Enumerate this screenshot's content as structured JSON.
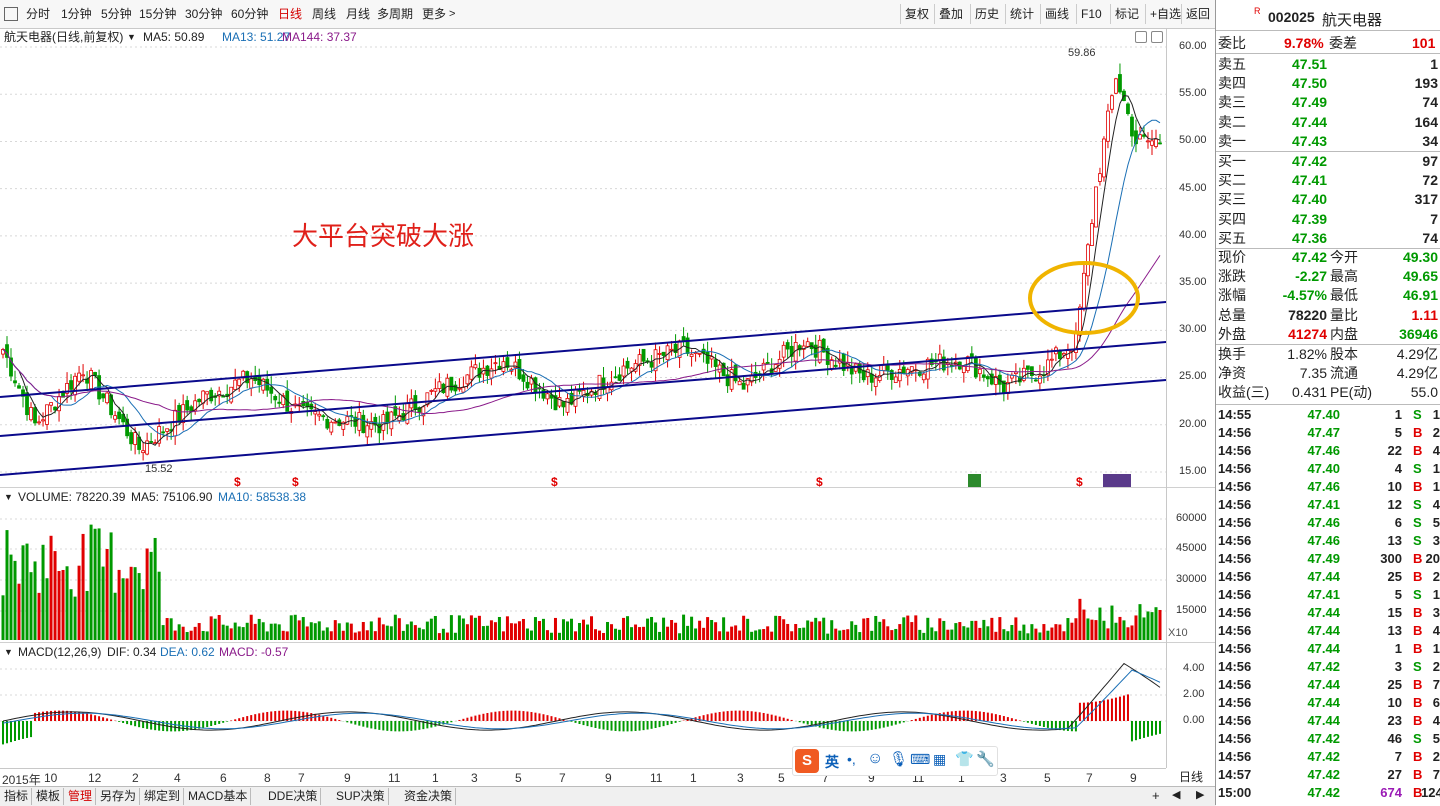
{
  "toolbar": {
    "periods": [
      "分时",
      "1分钟",
      "5分钟",
      "15分钟",
      "30分钟",
      "60分钟",
      "日线",
      "周线",
      "月线",
      "多周期",
      "更多"
    ],
    "active_period": "日线",
    "right_buttons": [
      "复权",
      "叠加",
      "历史",
      "统计",
      "画线",
      "F10",
      "标记",
      "+自选",
      "返回"
    ]
  },
  "chart_info": {
    "stock_label": "航天电器(日线,前复权)",
    "ma5": "MA5: 50.89",
    "ma13": "MA13: 51.27",
    "ma144": "MA144: 37.37",
    "volume": "VOLUME: 78220.39",
    "vol_ma5": "MA5: 75106.90",
    "vol_ma10": "MA10: 58538.38",
    "macd": "MACD(12,26,9)",
    "dif": "DIF: 0.34",
    "dea": "DEA: 0.62",
    "macd_val": "MACD: -0.57"
  },
  "annotations": {
    "title": "大平台突破大涨",
    "high_label": "59.86",
    "low_label": "15.52",
    "x10": "X10"
  },
  "price_axis": [
    "60.00",
    "55.00",
    "50.00",
    "45.00",
    "40.00",
    "35.00",
    "30.00",
    "25.00",
    "20.00",
    "15.00"
  ],
  "volume_axis": [
    "60000",
    "45000",
    "30000",
    "15000"
  ],
  "macd_axis": [
    "4.00",
    "2.00",
    "0.00"
  ],
  "date_axis": [
    "2015年",
    "10",
    "12",
    "2",
    "4",
    "6",
    "8",
    "7",
    "9",
    "11",
    "1",
    "3",
    "5",
    "7",
    "9",
    "11",
    "1",
    "3",
    "5",
    "7",
    "9",
    "11",
    "1",
    "3",
    "5",
    "7",
    "9"
  ],
  "bottom_tabs": [
    "指标",
    "模板",
    "管理",
    "另存为",
    "绑定到",
    "MACD基本",
    "DDE决策",
    "SUP决策",
    "资金决策"
  ],
  "bottom_active": "管理",
  "period_tag": "日线",
  "ime": [
    "英",
    "设置"
  ],
  "quote": {
    "code": "002025",
    "name": "航天电器",
    "weibi_label": "委比",
    "weibi": "9.78%",
    "weicha_label": "委差",
    "weicha": "101",
    "sells": [
      {
        "label": "卖五",
        "price": "47.51",
        "vol": "1"
      },
      {
        "label": "卖四",
        "price": "47.50",
        "vol": "193"
      },
      {
        "label": "卖三",
        "price": "47.49",
        "vol": "74"
      },
      {
        "label": "卖二",
        "price": "47.44",
        "vol": "164"
      },
      {
        "label": "卖一",
        "price": "47.43",
        "vol": "34"
      }
    ],
    "buys": [
      {
        "label": "买一",
        "price": "47.42",
        "vol": "97"
      },
      {
        "label": "买二",
        "price": "47.41",
        "vol": "72"
      },
      {
        "label": "买三",
        "price": "47.40",
        "vol": "317"
      },
      {
        "label": "买四",
        "price": "47.39",
        "vol": "7"
      },
      {
        "label": "买五",
        "price": "47.36",
        "vol": "74"
      }
    ],
    "stats": [
      {
        "l1": "现价",
        "v1": "47.42",
        "c1": "green",
        "l2": "今开",
        "v2": "49.30",
        "c2": "green"
      },
      {
        "l1": "涨跌",
        "v1": "-2.27",
        "c1": "green",
        "l2": "最高",
        "v2": "49.65",
        "c2": "green"
      },
      {
        "l1": "涨幅",
        "v1": "-4.57%",
        "c1": "green",
        "l2": "最低",
        "v2": "46.91",
        "c2": "green"
      },
      {
        "l1": "总量",
        "v1": "78220",
        "c1": "black",
        "l2": "量比",
        "v2": "1.11",
        "c2": "red"
      },
      {
        "l1": "外盘",
        "v1": "41274",
        "c1": "red",
        "l2": "内盘",
        "v2": "36946",
        "c2": "green"
      }
    ],
    "stats2": [
      {
        "l1": "换手",
        "v1": "1.82%",
        "l2": "股本",
        "v2": "4.29亿"
      },
      {
        "l1": "净资",
        "v1": "7.35",
        "l2": "流通",
        "v2": "4.29亿"
      },
      {
        "l1": "收益(三)",
        "v1": "0.431",
        "l2": "PE(动)",
        "v2": "55.0"
      }
    ],
    "ticks": [
      {
        "t": "14:55",
        "p": "47.40",
        "v": "1",
        "s": "S",
        "n": "1"
      },
      {
        "t": "14:56",
        "p": "47.47",
        "v": "5",
        "s": "B",
        "n": "2"
      },
      {
        "t": "14:56",
        "p": "47.46",
        "v": "22",
        "s": "B",
        "n": "4"
      },
      {
        "t": "14:56",
        "p": "47.40",
        "v": "4",
        "s": "S",
        "n": "1"
      },
      {
        "t": "14:56",
        "p": "47.46",
        "v": "10",
        "s": "B",
        "n": "1"
      },
      {
        "t": "14:56",
        "p": "47.41",
        "v": "12",
        "s": "S",
        "n": "4"
      },
      {
        "t": "14:56",
        "p": "47.46",
        "v": "6",
        "s": "S",
        "n": "5"
      },
      {
        "t": "14:56",
        "p": "47.46",
        "v": "13",
        "s": "S",
        "n": "3"
      },
      {
        "t": "14:56",
        "p": "47.49",
        "v": "300",
        "s": "B",
        "n": "20"
      },
      {
        "t": "14:56",
        "p": "47.44",
        "v": "25",
        "s": "B",
        "n": "2"
      },
      {
        "t": "14:56",
        "p": "47.41",
        "v": "5",
        "s": "S",
        "n": "1"
      },
      {
        "t": "14:56",
        "p": "47.44",
        "v": "15",
        "s": "B",
        "n": "3"
      },
      {
        "t": "14:56",
        "p": "47.44",
        "v": "13",
        "s": "B",
        "n": "4"
      },
      {
        "t": "14:56",
        "p": "47.44",
        "v": "1",
        "s": "B",
        "n": "1"
      },
      {
        "t": "14:56",
        "p": "47.42",
        "v": "3",
        "s": "S",
        "n": "2"
      },
      {
        "t": "14:56",
        "p": "47.44",
        "v": "25",
        "s": "B",
        "n": "7"
      },
      {
        "t": "14:56",
        "p": "47.44",
        "v": "10",
        "s": "B",
        "n": "6"
      },
      {
        "t": "14:56",
        "p": "47.44",
        "v": "23",
        "s": "B",
        "n": "4"
      },
      {
        "t": "14:56",
        "p": "47.42",
        "v": "46",
        "s": "S",
        "n": "5"
      },
      {
        "t": "14:56",
        "p": "47.42",
        "v": "7",
        "s": "B",
        "n": "2"
      },
      {
        "t": "14:57",
        "p": "47.42",
        "v": "27",
        "s": "B",
        "n": "7"
      },
      {
        "t": "15:00",
        "p": "47.42",
        "v": "674",
        "s": "B",
        "n": "124"
      }
    ]
  },
  "colors": {
    "up": "#e00000",
    "down": "#009900",
    "ma5": "#000000",
    "ma13": "#1a6fb5",
    "ma144": "#8a1a8a",
    "channel": "#0a0a8c",
    "circle": "#f0b400",
    "annotation": "#e0201a"
  }
}
